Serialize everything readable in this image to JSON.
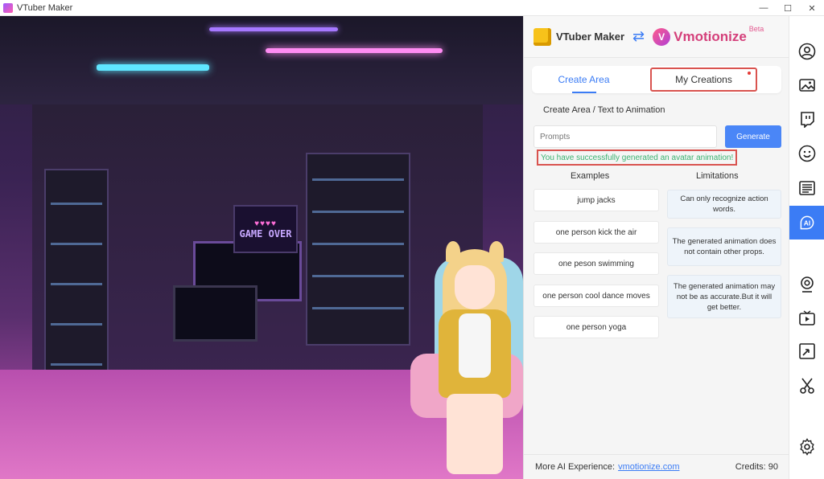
{
  "window": {
    "title": "VTuber Maker",
    "controls": [
      "—",
      "☐",
      "✕"
    ]
  },
  "scene": {
    "game_over_text": "GAME OVER",
    "hearts": "♥♥♥♥"
  },
  "brand": {
    "vtuber_maker": "VTuber Maker",
    "vmotionize": "Vmotionize",
    "beta": "Beta"
  },
  "tabs": {
    "create_area": "Create Area",
    "my_creations": "My Creations"
  },
  "breadcrumb": "Create Area / Text to Animation",
  "prompt": {
    "placeholder": "Prompts",
    "value": ""
  },
  "generate_label": "Generate",
  "success_message": "You have successfully generated an avatar animation!",
  "examples": {
    "title": "Examples",
    "items": [
      "jump jacks",
      "one person kick the air",
      "one peson swimming",
      "one person cool dance moves",
      "one person yoga"
    ]
  },
  "limitations": {
    "title": "Limitations",
    "items": [
      "Can only recognize action words.",
      "The generated animation does not contain other props.",
      "The generated animation may not be as accurate.But it will get better."
    ]
  },
  "footer": {
    "more_label": "More AI Experience:",
    "link": "vmotionize.com",
    "credits": "Credits: 90"
  },
  "toolbar": {
    "items": [
      {
        "icon": "user-icon",
        "glyph": "◯"
      },
      {
        "icon": "image-icon",
        "glyph": "▣"
      },
      {
        "icon": "twitch-icon",
        "glyph": "▤"
      },
      {
        "icon": "face-icon",
        "glyph": "☺"
      },
      {
        "icon": "document-icon",
        "glyph": "☰"
      },
      {
        "icon": "ai-icon",
        "glyph": "AI"
      },
      {
        "icon": "webcam-icon",
        "glyph": "◉"
      },
      {
        "icon": "video-icon",
        "glyph": "▶"
      },
      {
        "icon": "resize-icon",
        "glyph": "⤡"
      },
      {
        "icon": "scissors-icon",
        "glyph": "✂"
      },
      {
        "icon": "settings-icon",
        "glyph": "⚙"
      }
    ],
    "active_index": 5
  },
  "colors": {
    "accent": "#3b7cf5",
    "success": "#3cb371",
    "highlight": "#d9534f"
  }
}
